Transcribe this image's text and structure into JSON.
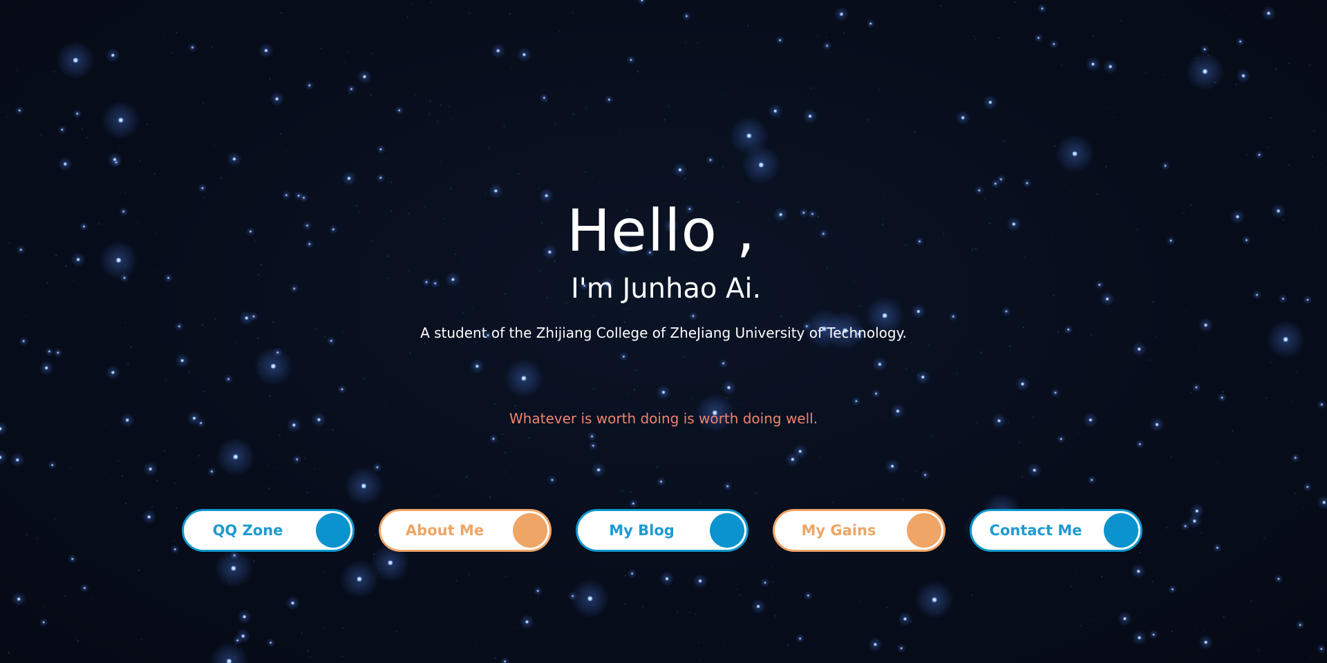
{
  "hero": {
    "greeting": "Hello ,",
    "name": "I'm Junhao Ai.",
    "subtitle": "A student of the Zhijiang College of ZheJiang University of Technology.",
    "motto": "Whatever is worth doing is worth doing well."
  },
  "nav": {
    "buttons": [
      {
        "label": "QQ Zone",
        "theme": "blue"
      },
      {
        "label": "About Me",
        "theme": "orange"
      },
      {
        "label": "My Blog",
        "theme": "blue"
      },
      {
        "label": "My Gains",
        "theme": "orange"
      },
      {
        "label": "Contact Me",
        "theme": "blue"
      }
    ]
  },
  "colors": {
    "background": "#060c19",
    "text": "#ffffff",
    "motto": "#f0836f",
    "blue_accent": "#0a93cf",
    "orange_accent": "#eea565",
    "star": "#9cc4ff"
  }
}
